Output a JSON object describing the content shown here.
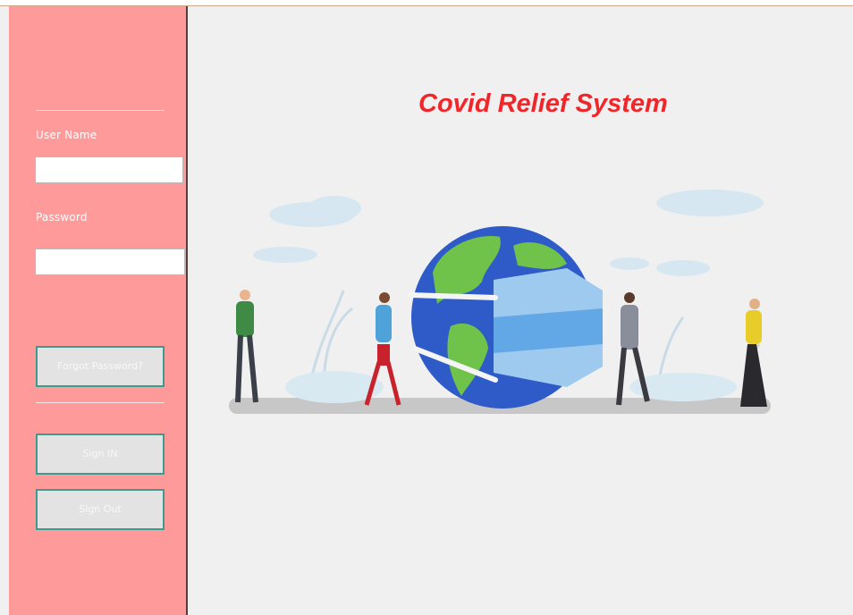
{
  "app": {
    "title": "Covid Relief System"
  },
  "login": {
    "username_label": "User Name",
    "username_value": "",
    "password_label": "Password",
    "password_value": "",
    "forgot_label": "Forgot Password?",
    "signin_label": "Sign IN",
    "signout_label": "Sign Out"
  },
  "colors": {
    "sidebar": "#ff9a9a",
    "title": "#f0262a",
    "button_border": "#3d9a8e",
    "background": "#f0f0f0"
  },
  "illustration": {
    "icon": "people-with-masked-globe-illustration"
  }
}
